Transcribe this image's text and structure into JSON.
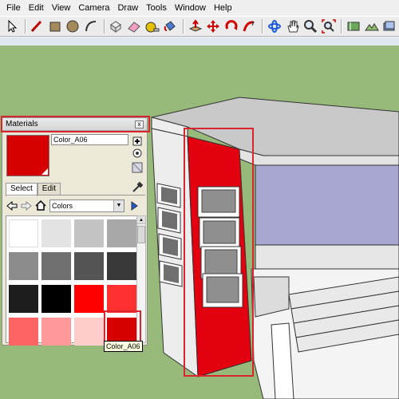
{
  "menu": [
    "File",
    "Edit",
    "View",
    "Camera",
    "Draw",
    "Tools",
    "Window",
    "Help"
  ],
  "toolbar": {
    "tools": [
      "select-arrow-icon",
      "pencil-line-icon",
      "rectangle-icon",
      "circle-icon",
      "arc-icon",
      "make-component-icon",
      "eraser-icon",
      "tape-measure-icon",
      "paint-bucket-icon",
      "push-pull-icon",
      "move-icon",
      "rotate-icon",
      "follow-me-icon",
      "orbit-icon",
      "pan-hand-icon",
      "zoom-icon",
      "zoom-extents-icon",
      "add-location-icon",
      "toggle-terrain-icon",
      "get-models-icon"
    ]
  },
  "materials": {
    "title": "Materials",
    "close_label": "x",
    "current_name": "Color_A06",
    "current_color": "#d60000",
    "tabs": [
      "Select",
      "Edit"
    ],
    "library": "Colors",
    "swatches": [
      "#ffffff",
      "#e3e3e3",
      "#c4c4c4",
      "#a8a8a8",
      "#8c8c8c",
      "#6f6f6f",
      "#545454",
      "#383838",
      "#1d1d1d",
      "#000000",
      "#ff0000",
      "#ff3030",
      "#ff6464",
      "#ff9898",
      "#ffcccc",
      "#d60000"
    ],
    "tooltip": "Color_A06"
  },
  "colors": {
    "highlight": "#d9252d",
    "ground": "#97b97a",
    "sky": "#dfe8ee",
    "wall_red": "#e3000f"
  }
}
